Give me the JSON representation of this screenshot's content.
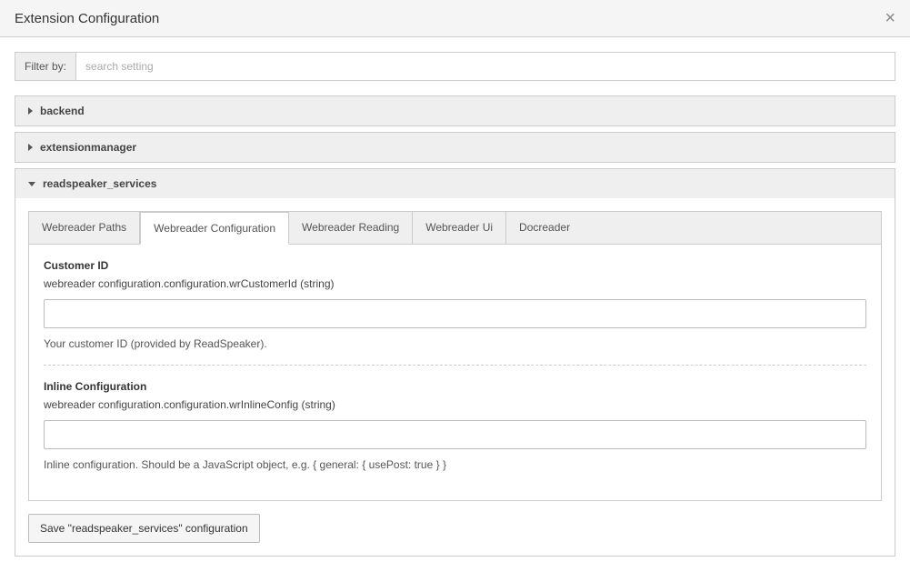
{
  "header": {
    "title": "Extension Configuration"
  },
  "filter": {
    "label": "Filter by:",
    "placeholder": "search setting",
    "value": ""
  },
  "categories": [
    {
      "key": "backend",
      "label": "backend",
      "expanded": false
    },
    {
      "key": "extensionmanager",
      "label": "extensionmanager",
      "expanded": false
    },
    {
      "key": "readspeaker",
      "label": "readspeaker_services",
      "expanded": true
    }
  ],
  "tabs": [
    {
      "label": "Webreader Paths",
      "active": false
    },
    {
      "label": "Webreader Configuration",
      "active": true
    },
    {
      "label": "Webreader Reading",
      "active": false
    },
    {
      "label": "Webreader Ui",
      "active": false
    },
    {
      "label": "Docreader",
      "active": false
    }
  ],
  "fields": [
    {
      "title": "Customer ID",
      "path": "webreader configuration.configuration.wrCustomerId (string)",
      "value": "",
      "help": "Your customer ID (provided by ReadSpeaker)."
    },
    {
      "title": "Inline Configuration",
      "path": "webreader configuration.configuration.wrInlineConfig (string)",
      "value": "",
      "help": "Inline configuration. Should be a JavaScript object, e.g. { general: { usePost: true } }"
    }
  ],
  "saveButton": "Save \"readspeaker_services\" configuration"
}
